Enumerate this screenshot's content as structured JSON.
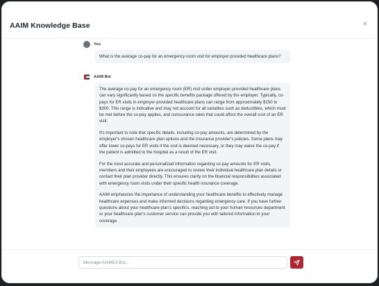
{
  "header": {
    "title": "AAIM Knowledge Base",
    "close_symbol": "×"
  },
  "messages": [
    {
      "sender": "You",
      "paragraphs": [
        "What is the average co-pay for an emergency room visit for employer provided healthcare plans?"
      ]
    },
    {
      "sender": "AAIM Bot",
      "paragraphs": [
        "The average co-pay for an emergency room (ER) visit under employer-provided healthcare plans can vary significantly based on the specific benefits package offered by the employer. Typically, co-pays for ER visits in employer-provided healthcare plans can range from approximately $150 to $300. This range is indicative and may not account for all variables such as deductibles, which must be met before the co-pay applies, and coinsurance rates that could affect the overall cost of an ER visit.",
        "It's important to note that specific details, including co-pay amounts, are determined by the employer's chosen healthcare plan options and the insurance provider's policies. Some plans may offer lower co-pays for ER visits if the visit is deemed necessary, or they may waive the co-pay if the patient is admitted to the hospital as a result of the ER visit.",
        "For the most accurate and personalized information regarding co-pay amounts for ER visits, members and their employees are encouraged to review their individual healthcare plan details or contact their plan provider directly. This ensures clarity on the financial responsibilities associated with emergency room visits under their specific health insurance coverage.",
        "AAIM emphasizes the importance of understanding your healthcare benefits to effectively manage healthcare expenses and make informed decisions regarding emergency care. If you have further questions about your healthcare plan's specifics, reaching out to your human resources department or your healthcare plan's customer service can provide you with tailored information to your coverage."
      ]
    }
  ],
  "composer": {
    "placeholder": "Message AAIMEA Bot...",
    "value": ""
  },
  "colors": {
    "accent": "#b0262f",
    "bubble_bg": "#f3f4f6",
    "backdrop": "#1f2022"
  },
  "icons": {
    "close": "close-icon",
    "user_avatar": "user-avatar-icon",
    "bot_logo": "aaim-bot-logo-icon",
    "send": "send-icon"
  }
}
